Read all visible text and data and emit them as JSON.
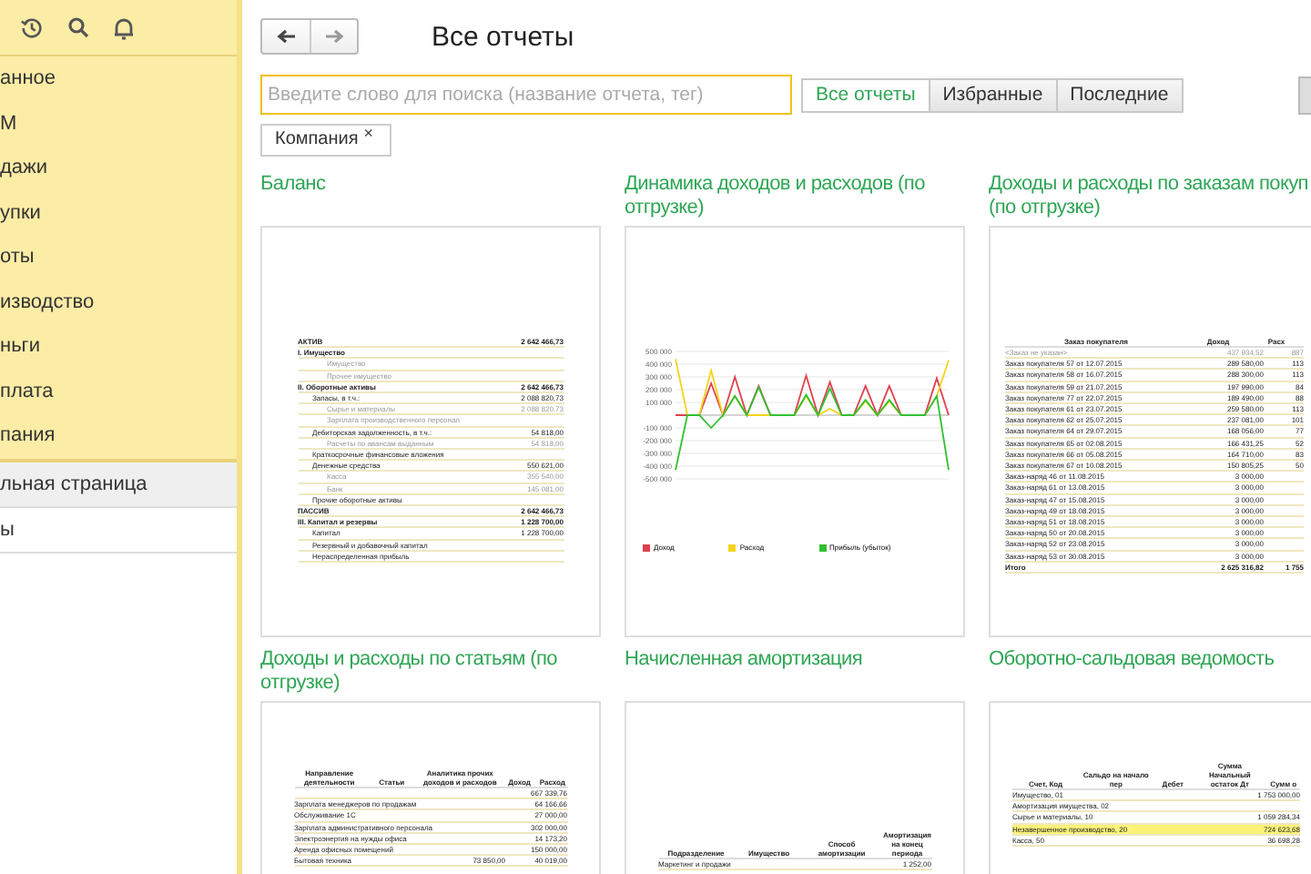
{
  "sidebar": {
    "items": [
      {
        "label": "анное",
        "selected": false
      },
      {
        "label": "М",
        "selected": false
      },
      {
        "label": "дажи",
        "selected": false
      },
      {
        "label": "упки",
        "selected": false
      },
      {
        "label": "оты",
        "selected": false
      },
      {
        "label": "изводство",
        "selected": false
      },
      {
        "label": "ньги",
        "selected": false
      },
      {
        "label": "плата",
        "selected": false
      },
      {
        "label": "пания",
        "selected": false
      }
    ],
    "pages": [
      {
        "label": "льная страница",
        "selected": false
      },
      {
        "label": "ы",
        "selected": true
      }
    ]
  },
  "title": "Все отчеты",
  "search": {
    "placeholder": "Введите слово для поиска (название отчета, тег)"
  },
  "filters": [
    {
      "label": "Все отчеты",
      "selected": true
    },
    {
      "label": "Избранные",
      "selected": false
    },
    {
      "label": "Последние",
      "selected": false
    }
  ],
  "tags": [
    {
      "label": "Компания",
      "remove": "×"
    }
  ],
  "reports": [
    {
      "title": "Баланс",
      "kind": "balance",
      "rows": [
        {
          "kind": "section",
          "label": "АКТИВ",
          "value": "2 642 466,73"
        },
        {
          "kind": "section",
          "label": "I. Имущество"
        },
        {
          "kind": "item",
          "label": "Имущество"
        },
        {
          "kind": "item",
          "label": "Прочее имущество"
        },
        {
          "kind": "section",
          "label": "II. Оборотные активы",
          "value": "2 642 466,73"
        },
        {
          "kind": "group",
          "label": "Запасы, в т.ч.:",
          "value": "2 088 820,73"
        },
        {
          "kind": "item",
          "label": "Сырье и материалы",
          "value": "2 088 820,73"
        },
        {
          "kind": "item",
          "label": "Зарплата производственного персонал"
        },
        {
          "kind": "group",
          "label": "Дебиторская задолженность, в т.ч.:",
          "value": "54 818,00"
        },
        {
          "kind": "item",
          "label": "Расчеты по авансам выданным",
          "value": "54 818,00"
        },
        {
          "kind": "group",
          "label": "Краткосрочные финансовые вложения"
        },
        {
          "kind": "group",
          "label": "Денежные средства",
          "value": "550 621,00"
        },
        {
          "kind": "item",
          "label": "Касса",
          "value": "355 540,00"
        },
        {
          "kind": "item",
          "label": "Банк",
          "value": "145 081,00"
        },
        {
          "kind": "group",
          "label": "Прочие оборотные активы"
        },
        {
          "kind": "section",
          "label": "ПАССИВ",
          "value": "2 642 466,73"
        },
        {
          "kind": "section",
          "label": "III. Капитал и резервы",
          "value": "1 228 700,00"
        },
        {
          "kind": "group",
          "label": "Капитал",
          "value": "1 228 700,00"
        },
        {
          "kind": "group",
          "label": "Резервный и добавочный капитал"
        },
        {
          "kind": "group",
          "label": "Нераспределенная прибыль"
        }
      ]
    },
    {
      "title": "Динамика доходов и расходов (по отгрузке)",
      "kind": "chart",
      "chart_data": {
        "type": "line",
        "grid": true,
        "legend": "bottom",
        "ylim": [
          -500000,
          500000
        ],
        "yticks": [
          {
            "value": 500000,
            "label": "500 000"
          },
          {
            "value": 400000,
            "label": "400 000"
          },
          {
            "value": 300000,
            "label": "300 000"
          },
          {
            "value": 200000,
            "label": "200 000"
          },
          {
            "value": 100000,
            "label": "100 000"
          },
          {
            "value": -100000,
            "label": "-100 000"
          },
          {
            "value": -200000,
            "label": "-200 000"
          },
          {
            "value": -300000,
            "label": "-300 000"
          },
          {
            "value": -400000,
            "label": "-400 000"
          },
          {
            "value": -500000,
            "label": "-500 000"
          }
        ],
        "series": [
          {
            "name": "Доход",
            "color": "#e0404c",
            "values": [
              0,
              0,
              0,
              250000,
              0,
              300000,
              0,
              230000,
              0,
              0,
              0,
              310000,
              0,
              260000,
              0,
              0,
              230000,
              0,
              230000,
              0,
              0,
              0,
              290000,
              0
            ]
          },
          {
            "name": "Расход",
            "color": "#f4d41c",
            "values": [
              440000,
              0,
              0,
              350000,
              0,
              150000,
              0,
              0,
              0,
              0,
              0,
              150000,
              0,
              50000,
              0,
              0,
              110000,
              0,
              110000,
              0,
              0,
              0,
              150000,
              430000
            ]
          },
          {
            "name": "Прибыль (убыток)",
            "color": "#30c030",
            "values": [
              -430000,
              0,
              0,
              -100000,
              0,
              150000,
              0,
              220000,
              0,
              0,
              0,
              160000,
              0,
              210000,
              0,
              0,
              120000,
              0,
              120000,
              0,
              0,
              0,
              150000,
              -430000
            ]
          }
        ]
      }
    },
    {
      "title": "Доходы и расходы по заказам покуп (по отгрузке)",
      "kind": "orders",
      "columns": [
        "Заказ покупателя",
        "Доход",
        "Расх"
      ],
      "rows": [
        {
          "muted": true,
          "label": "<Заказ не указан>",
          "income": "437 934,52",
          "expense": "887"
        },
        {
          "muted": false,
          "label": "Заказ покупателя 57 от 12.07.2015",
          "income": "289 580,00",
          "expense": "113"
        },
        {
          "muted": false,
          "label": "Заказ покупателя 58 от 16.07.2015",
          "income": "288 300,00",
          "expense": "113"
        },
        {
          "muted": false,
          "label": "Заказ покупателя 59 от 21.07.2015",
          "income": "197 990,00",
          "expense": "84"
        },
        {
          "muted": false,
          "label": "Заказ покупателя 77 от 22.07.2015",
          "income": "189 490,00",
          "expense": "88"
        },
        {
          "muted": false,
          "label": "Заказ покупателя 61 от 23.07.2015",
          "income": "259 580,00",
          "expense": "113"
        },
        {
          "muted": false,
          "label": "Заказ покупателя 62 от 25.07.2015",
          "income": "237 081,00",
          "expense": "101"
        },
        {
          "muted": false,
          "label": "Заказ покупателя 64 от 29.07.2015",
          "income": "168 056,00",
          "expense": "77"
        },
        {
          "muted": false,
          "label": "Заказ покупателя 65 от 02.08.2015",
          "income": "166 431,25",
          "expense": "52"
        },
        {
          "muted": false,
          "label": "Заказ покупателя 66 от 05.08.2015",
          "income": "164 710,00",
          "expense": "83"
        },
        {
          "muted": false,
          "label": "Заказ покупателя 67 от 10.08.2015",
          "income": "150 805,25",
          "expense": "50"
        },
        {
          "muted": false,
          "label": "Заказ-наряд 46 от 11.08.2015",
          "income": "3 000,00"
        },
        {
          "muted": false,
          "label": "Заказ-наряд 61 от 13.08.2015",
          "income": "3 000,00"
        },
        {
          "muted": false,
          "label": "Заказ-наряд 47 от 15.08.2015",
          "income": "3 000,00"
        },
        {
          "muted": false,
          "label": "Заказ-наряд 49 от 18.08.2015",
          "income": "3 000,00"
        },
        {
          "muted": false,
          "label": "Заказ-наряд 51 от 18.08.2015",
          "income": "3 000,00"
        },
        {
          "muted": false,
          "label": "Заказ-наряд 50 от 20.08.2015",
          "income": "3 000,00"
        },
        {
          "muted": false,
          "label": "Заказ-наряд 52 от 23.08.2015",
          "income": "3 000,00"
        },
        {
          "muted": false,
          "label": "Заказ-наряд 53 от 30.08.2015",
          "income": "3 000,00"
        }
      ],
      "total": {
        "label": "Итого",
        "income": "2 625 316,82",
        "expense": "1 755"
      }
    },
    {
      "title": "Доходы и расходы по статьям (по отгрузке)",
      "kind": "articles",
      "columns": [
        "Направление деятельности",
        "Статьи",
        "Аналитика прочих доходов и расходов",
        "Доход",
        "Расход"
      ],
      "rows": [
        {
          "expense": "667 339,76"
        },
        {
          "label": "Зарплата менеджеров по продажам",
          "expense": "64 166,66"
        },
        {
          "label": "Обслуживание 1С",
          "expense": "27 000,00"
        },
        {
          "label": "Зарплата административного персонала",
          "expense": "302 000,00"
        },
        {
          "label": "Электроэнергия на нужды офиса",
          "expense": "14 173,20"
        },
        {
          "label": "Аренда офисных помещений",
          "expense": "150 000,00"
        },
        {
          "label": "Бытовая техника",
          "income": "73 850,00",
          "expense": "40 019,00"
        }
      ]
    },
    {
      "title": "Начисленная амортизация",
      "kind": "amortization",
      "columns": [
        "Подразделение",
        "Имущество",
        "Способ амортизации",
        "Амортизация на конец периода"
      ],
      "rows": [
        {
          "label": "Маркетинг и продажи",
          "expense": "1 252,00"
        }
      ]
    },
    {
      "title": "Оборотно-сальдовая ведомость",
      "kind": "balance_sheet",
      "columns": [
        "Счет, Код",
        "Сальдо на начало пер",
        "Дебет",
        "Сумма Начальный остаток Дт",
        "Сумм о"
      ],
      "rows": [
        {
          "highlighted": false,
          "label": "Имущество, 01",
          "income": "1 753 000,00"
        },
        {
          "highlighted": false,
          "label": "Амортизация имущества, 02"
        },
        {
          "highlighted": false,
          "label": "Сырье и материалы, 10",
          "income": "1 059 284,34"
        },
        {
          "highlighted": true,
          "label": "Незавершенное производство, 20",
          "income": "724 623,68"
        },
        {
          "highlighted": false,
          "label": "Касса, 50",
          "income": "36 698,28"
        }
      ]
    }
  ]
}
